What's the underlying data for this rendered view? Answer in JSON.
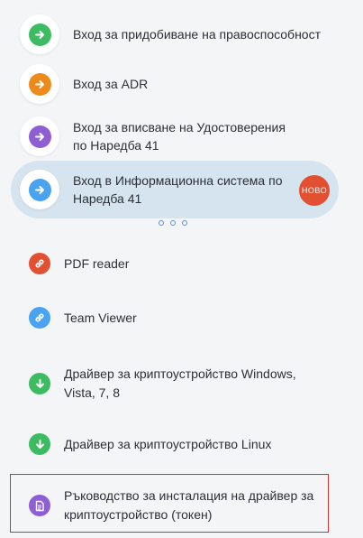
{
  "entries": [
    {
      "label": "Вход за придобиване на правоспособност",
      "color": "#3dbb61",
      "icon": "arrow-right-icon"
    },
    {
      "label": "Вход за ADR",
      "color": "#ee8a1c",
      "icon": "arrow-right-icon"
    },
    {
      "label": "Вход за вписване на Удостоверения по Наредба 41",
      "color": "#8e5fd2",
      "icon": "arrow-right-icon"
    },
    {
      "label": "Вход в Информационна система по Наредба 41",
      "color": "#4aa3f0",
      "icon": "arrow-right-icon",
      "active": true,
      "badge": "НОВО"
    }
  ],
  "pager": {
    "pages": 3
  },
  "links": [
    {
      "label": "PDF reader",
      "color": "#e34f31",
      "icon": "link-icon"
    },
    {
      "label": "Team Viewer",
      "color": "#4aa3f0",
      "icon": "link-icon"
    },
    {
      "label": "Драйвер за криптоустройство Windows, Vista, 7, 8",
      "color": "#3dbb61",
      "icon": "download-icon"
    },
    {
      "label": "Драйвер за криптоустройство Linux",
      "color": "#3dbb61",
      "icon": "download-icon"
    },
    {
      "label": "Ръководство за инсталация на драйвер за криптоустройство (токен)",
      "color": "#8e5fd2",
      "icon": "document-icon"
    }
  ]
}
